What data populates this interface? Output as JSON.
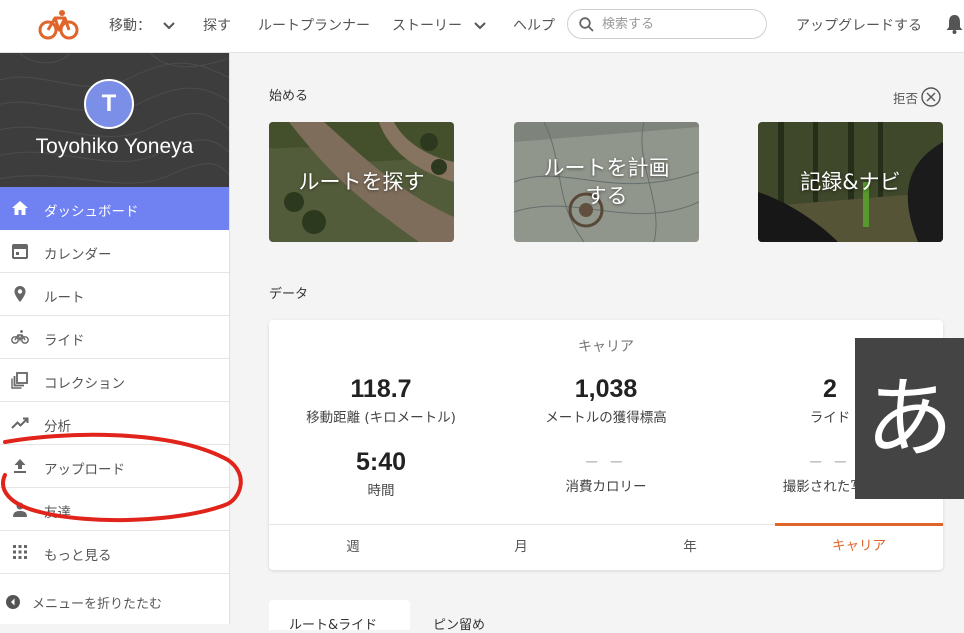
{
  "colors": {
    "accent": "#7081f2",
    "brand": "#e0652a",
    "sidebar_dark": "#3d3d3d"
  },
  "nav": {
    "move": "移動：",
    "explore": "探す",
    "route_planner": "ルートプランナー",
    "stories": "ストーリー",
    "help": "ヘルプ",
    "search_placeholder": "検索する",
    "upgrade": "アップグレードする"
  },
  "profile": {
    "initial": "T",
    "name": "Toyohiko Yoneya"
  },
  "sidebar": {
    "items": [
      {
        "label": "ダッシュボード",
        "icon": "home-icon",
        "active": true
      },
      {
        "label": "カレンダー",
        "icon": "calendar-icon"
      },
      {
        "label": "ルート",
        "icon": "pin-icon"
      },
      {
        "label": "ライド",
        "icon": "bike-icon"
      },
      {
        "label": "コレクション",
        "icon": "collection-icon"
      },
      {
        "label": "分析",
        "icon": "trend-icon"
      },
      {
        "label": "アップロード",
        "icon": "upload-icon"
      },
      {
        "label": "友達",
        "icon": "people-icon"
      },
      {
        "label": "もっと見る",
        "icon": "grid-icon"
      }
    ],
    "collapse": "メニューを折りたたむ"
  },
  "getting_started": {
    "title": "始める",
    "dismiss": "拒否",
    "cards": [
      {
        "label": "ルートを探す"
      },
      {
        "label": "ルートを計画する"
      },
      {
        "label": "記録&ナビ"
      }
    ]
  },
  "data": {
    "title": "データ",
    "career": "キャリア",
    "stats": [
      {
        "value": "118.7",
        "label": "移動距離 (キロメートル)"
      },
      {
        "value": "1,038",
        "label": "メートルの獲得標高"
      },
      {
        "value": "2",
        "label": "ライド"
      },
      {
        "value": "5:40",
        "label": "時間"
      },
      {
        "value": "‒ ‒",
        "label": "消費カロリー"
      },
      {
        "value": "‒ ‒",
        "label": "撮影された写真"
      }
    ],
    "tabs": [
      "週",
      "月",
      "年",
      "キャリア"
    ]
  },
  "bottom_tabs": [
    "ルート&ライド",
    "ピン留め"
  ],
  "ime_indicator": "あ"
}
